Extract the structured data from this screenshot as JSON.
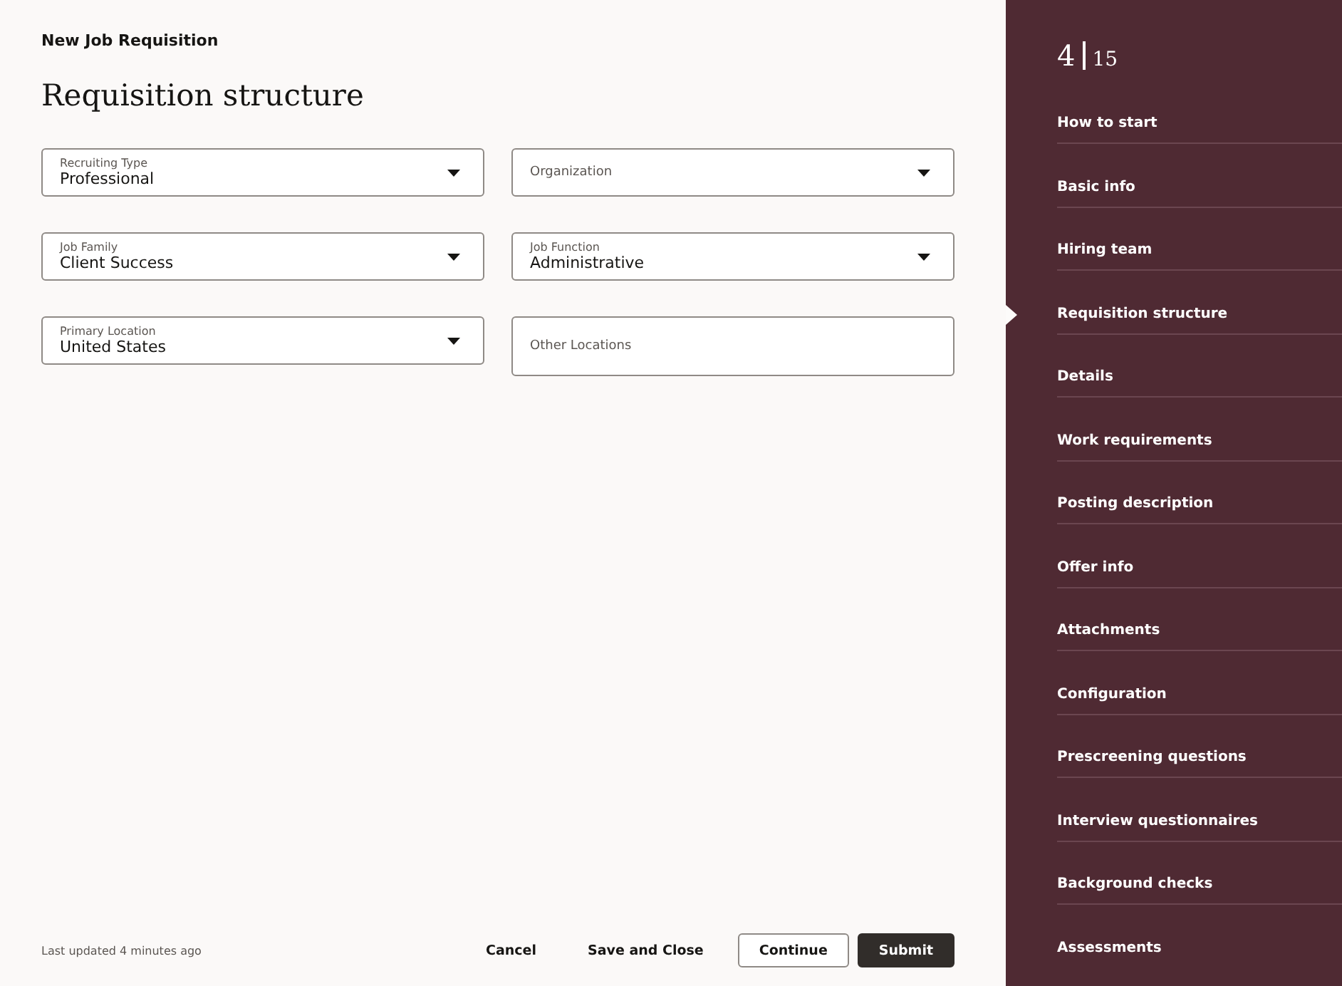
{
  "header": {
    "context": "New Job Requisition",
    "title": "Requisition structure"
  },
  "fields": [
    {
      "kind": "select",
      "label": "Recruiting Type",
      "value": "Professional"
    },
    {
      "kind": "select",
      "label": "Organization"
    },
    {
      "kind": "select",
      "label": "Job Family",
      "value": "Client Success"
    },
    {
      "kind": "select",
      "label": "Job Function",
      "value": "Administrative"
    },
    {
      "kind": "select",
      "label": "Primary Location",
      "value": "United States"
    },
    {
      "kind": "text",
      "label": "Other Locations"
    }
  ],
  "footer": {
    "status": "Last updated 4 minutes ago",
    "buttons": [
      {
        "kind": "link",
        "label": "Cancel"
      },
      {
        "kind": "link",
        "label": "Save and Close"
      },
      {
        "kind": "outline",
        "label": "Continue"
      },
      {
        "kind": "primary",
        "label": "Submit"
      }
    ]
  },
  "sidebar": {
    "step": "4",
    "total": "15",
    "items": [
      {
        "label": "How to start",
        "selected": false
      },
      {
        "label": "Basic info",
        "selected": false
      },
      {
        "label": "Hiring team",
        "selected": false
      },
      {
        "label": "Requisition structure",
        "selected": true
      },
      {
        "label": "Details",
        "selected": false
      },
      {
        "label": "Work requirements",
        "selected": false
      },
      {
        "label": "Posting description",
        "selected": false
      },
      {
        "label": "Offer info",
        "selected": false
      },
      {
        "label": "Attachments",
        "selected": false
      },
      {
        "label": "Configuration",
        "selected": false
      },
      {
        "label": "Prescreening questions",
        "selected": false
      },
      {
        "label": "Interview questionnaires",
        "selected": false
      },
      {
        "label": "Background checks",
        "selected": false
      },
      {
        "label": "Assessments",
        "selected": false
      }
    ]
  }
}
